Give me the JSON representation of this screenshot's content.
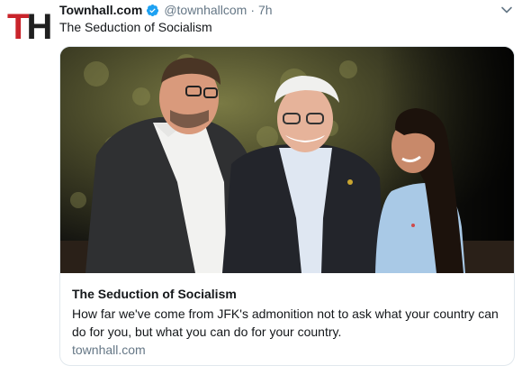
{
  "tweet": {
    "author_name": "Townhall.com",
    "author_handle": "@townhallcom",
    "separator": "·",
    "time": "7h",
    "text": "The Seduction of Socialism",
    "avatar_letters": {
      "first": "T",
      "second": "H"
    }
  },
  "card": {
    "title": "The Seduction of Socialism",
    "description": "How far we've come from JFK's admonition not to ask what your country can do for you, but what you can do for your country.",
    "domain": "townhall.com"
  },
  "colors": {
    "avatar_red": "#c9242b",
    "verified_blue": "#1da1f2",
    "secondary_text": "#657786",
    "border": "#e1e8ed"
  },
  "icons": {
    "verified": "verified-badge-icon",
    "menu": "chevron-down-icon"
  }
}
